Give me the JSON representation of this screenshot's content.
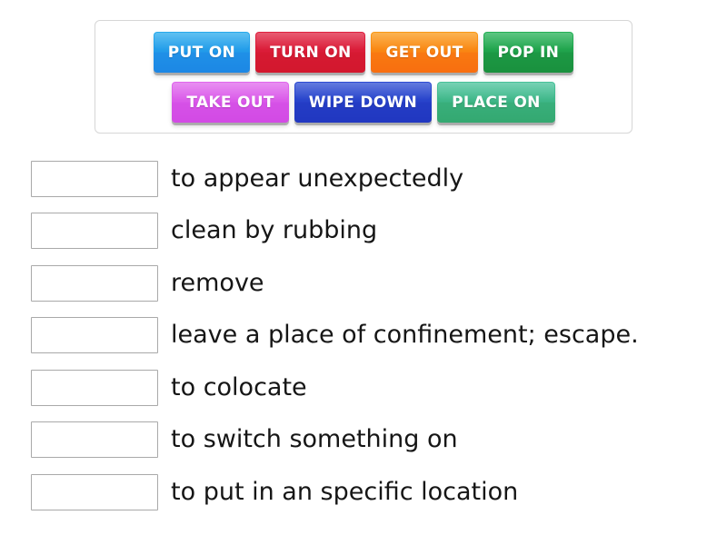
{
  "word_bank": {
    "rows": [
      [
        {
          "label": "PUT ON",
          "color": "#2196e8"
        },
        {
          "label": "TURN ON",
          "color": "#d81b35"
        },
        {
          "label": "GET OUT",
          "color": "#f98012"
        },
        {
          "label": "POP IN",
          "color": "#1e9e48"
        }
      ],
      [
        {
          "label": "TAKE OUT",
          "color": "#d856e8"
        },
        {
          "label": "WIPE DOWN",
          "color": "#2640c8"
        },
        {
          "label": "PLACE ON",
          "color": "#3cb382"
        }
      ]
    ]
  },
  "answers": [
    {
      "slot_value": "",
      "definition": "to appear unexpectedly"
    },
    {
      "slot_value": "",
      "definition": "clean by rubbing"
    },
    {
      "slot_value": "",
      "definition": "remove"
    },
    {
      "slot_value": "",
      "definition": "leave a place of confinement; escape."
    },
    {
      "slot_value": "",
      "definition": "to colocate"
    },
    {
      "slot_value": "",
      "definition": "to switch something on"
    },
    {
      "slot_value": "",
      "definition": "to put in an specific location"
    }
  ]
}
